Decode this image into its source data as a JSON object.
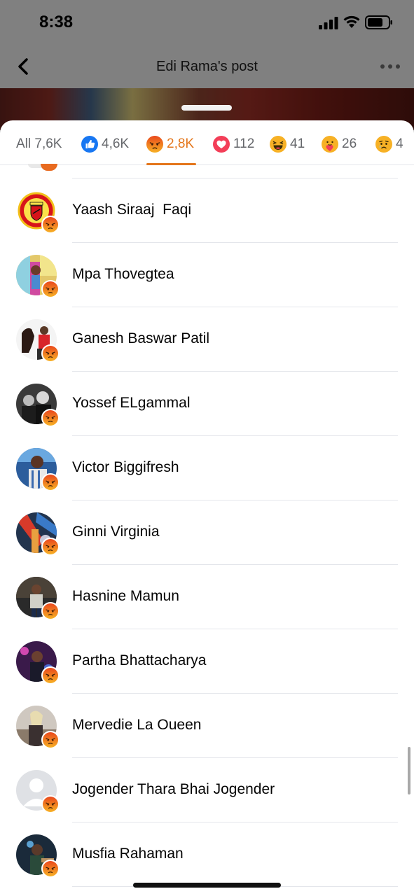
{
  "status_bar": {
    "time": "8:38"
  },
  "header": {
    "title": "Edi Rama's post"
  },
  "tabs": [
    {
      "label": "All 7,6K",
      "icon": "none",
      "active": false
    },
    {
      "label": "4,6K",
      "icon": "like-icon",
      "active": false
    },
    {
      "label": "2,8K",
      "icon": "angry-icon",
      "active": true
    },
    {
      "label": "112",
      "icon": "love-icon",
      "active": false
    },
    {
      "label": "41",
      "icon": "haha-icon",
      "active": false
    },
    {
      "label": "26",
      "icon": "care-icon",
      "active": false
    },
    {
      "label": "4",
      "icon": "sad-icon",
      "active": false
    }
  ],
  "people": [
    {
      "name": "Yaash Siraaj  Faqi",
      "avatar": "club-crest"
    },
    {
      "name": "Mpa Thovegtea",
      "avatar": "colorful"
    },
    {
      "name": "Ganesh Baswar Patil",
      "avatar": "horse"
    },
    {
      "name": "Yossef ELgammal",
      "avatar": "group-bw"
    },
    {
      "name": "Victor Biggifresh",
      "avatar": "person-blue"
    },
    {
      "name": "Ginni Virginia",
      "avatar": "colorful-dark"
    },
    {
      "name": "Hasnine Mamun",
      "avatar": "person-dark"
    },
    {
      "name": "Partha Bhattacharya",
      "avatar": "person-purple"
    },
    {
      "name": "Mervedie La Oueen",
      "avatar": "person-light"
    },
    {
      "name": "Jogender Thara Bhai Jogender",
      "avatar": "default"
    },
    {
      "name": "Musfia Rahaman",
      "avatar": "person-night"
    }
  ],
  "colors": {
    "angry_accent": "#e4761b",
    "like_blue": "#1877f2",
    "love_red": "#f33e58",
    "divider": "#e4e6eb"
  }
}
